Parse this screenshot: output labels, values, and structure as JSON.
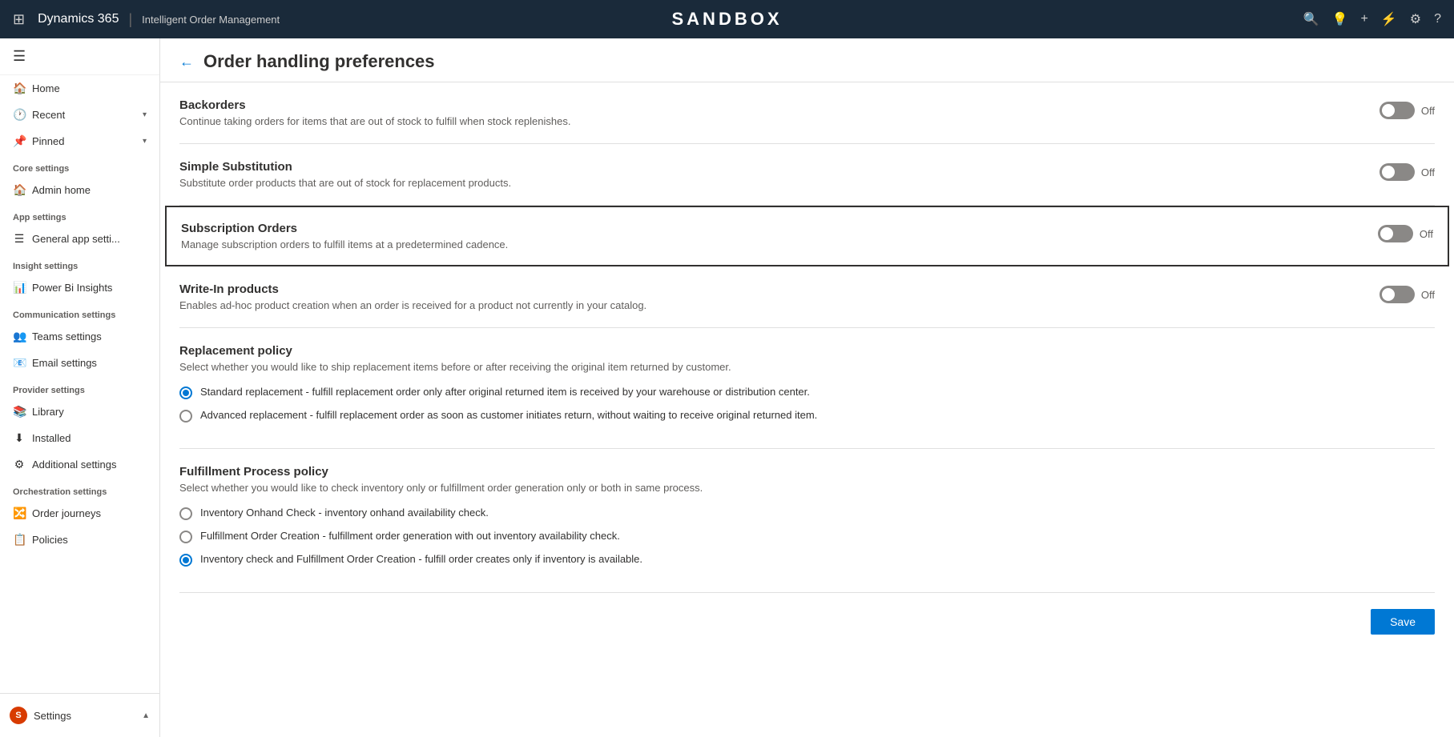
{
  "topnav": {
    "waffle_label": "⊞",
    "brand": "Dynamics 365",
    "divider": "|",
    "module": "Intelligent Order Management",
    "sandbox_title": "SANDBOX",
    "icons": [
      "🔍",
      "💡",
      "+",
      "⚡",
      "⚙",
      "?"
    ]
  },
  "sidebar": {
    "hamburger": "☰",
    "nav_items": [
      {
        "id": "home",
        "icon": "🏠",
        "label": "Home",
        "has_chevron": false
      },
      {
        "id": "recent",
        "icon": "🕐",
        "label": "Recent",
        "has_chevron": true
      },
      {
        "id": "pinned",
        "icon": "📌",
        "label": "Pinned",
        "has_chevron": true
      }
    ],
    "sections": [
      {
        "header": "Core settings",
        "items": [
          {
            "id": "admin-home",
            "icon": "🏠",
            "label": "Admin home"
          }
        ]
      },
      {
        "header": "App settings",
        "items": [
          {
            "id": "general-app",
            "icon": "☰",
            "label": "General app setti..."
          }
        ]
      },
      {
        "header": "Insight settings",
        "items": [
          {
            "id": "power-bi",
            "icon": "📊",
            "label": "Power Bi Insights"
          }
        ]
      },
      {
        "header": "Communication settings",
        "items": [
          {
            "id": "teams",
            "icon": "👥",
            "label": "Teams settings"
          },
          {
            "id": "email",
            "icon": "📧",
            "label": "Email settings"
          }
        ]
      },
      {
        "header": "Provider settings",
        "items": [
          {
            "id": "library",
            "icon": "📚",
            "label": "Library"
          },
          {
            "id": "installed",
            "icon": "⬇",
            "label": "Installed"
          },
          {
            "id": "additional",
            "icon": "⚙",
            "label": "Additional settings"
          }
        ]
      },
      {
        "header": "Orchestration settings",
        "items": [
          {
            "id": "order-journeys",
            "icon": "🔀",
            "label": "Order journeys"
          },
          {
            "id": "policies",
            "icon": "📋",
            "label": "Policies"
          }
        ]
      }
    ],
    "bottom": {
      "avatar_letter": "S",
      "label": "Settings",
      "chevron": "▲"
    }
  },
  "main": {
    "back_button": "←",
    "title": "Order handling preferences",
    "settings": [
      {
        "id": "backorders",
        "name": "Backorders",
        "description": "Continue taking orders for items that are out of stock to fulfill when stock replenishes.",
        "toggle_state": "Off",
        "highlighted": false
      },
      {
        "id": "simple-substitution",
        "name": "Simple Substitution",
        "description": "Substitute order products that are out of stock for replacement products.",
        "toggle_state": "Off",
        "highlighted": false
      },
      {
        "id": "subscription-orders",
        "name": "Subscription Orders",
        "description": "Manage subscription orders to fulfill items at a predetermined cadence.",
        "toggle_state": "Off",
        "highlighted": true
      },
      {
        "id": "write-in-products",
        "name": "Write-In products",
        "description": "Enables ad-hoc product creation when an order is received for a product not currently in your catalog.",
        "toggle_state": "Off",
        "highlighted": false
      }
    ],
    "replacement_policy": {
      "title": "Replacement policy",
      "description": "Select whether you would like to ship replacement items before or after receiving the original item returned by customer.",
      "options": [
        {
          "id": "standard",
          "label": "Standard replacement - fulfill replacement order only after original returned item is received by your warehouse or distribution center.",
          "selected": true
        },
        {
          "id": "advanced",
          "label": "Advanced replacement - fulfill replacement order as soon as customer initiates return, without waiting to receive original returned item.",
          "selected": false
        }
      ]
    },
    "fulfillment_policy": {
      "title": "Fulfillment Process policy",
      "description": "Select whether you would like to check inventory only or fulfillment order generation only or both in same process.",
      "options": [
        {
          "id": "inventory-onhand",
          "label": "Inventory Onhand Check - inventory onhand availability check.",
          "selected": false
        },
        {
          "id": "fulfillment-order-creation",
          "label": "Fulfillment Order Creation - fulfillment order generation with out inventory availability check.",
          "selected": false
        },
        {
          "id": "inventory-and-fulfillment",
          "label": "Inventory check and Fulfillment Order Creation - fulfill order creates only if inventory is available.",
          "selected": true
        }
      ]
    },
    "save_button": "Save"
  }
}
